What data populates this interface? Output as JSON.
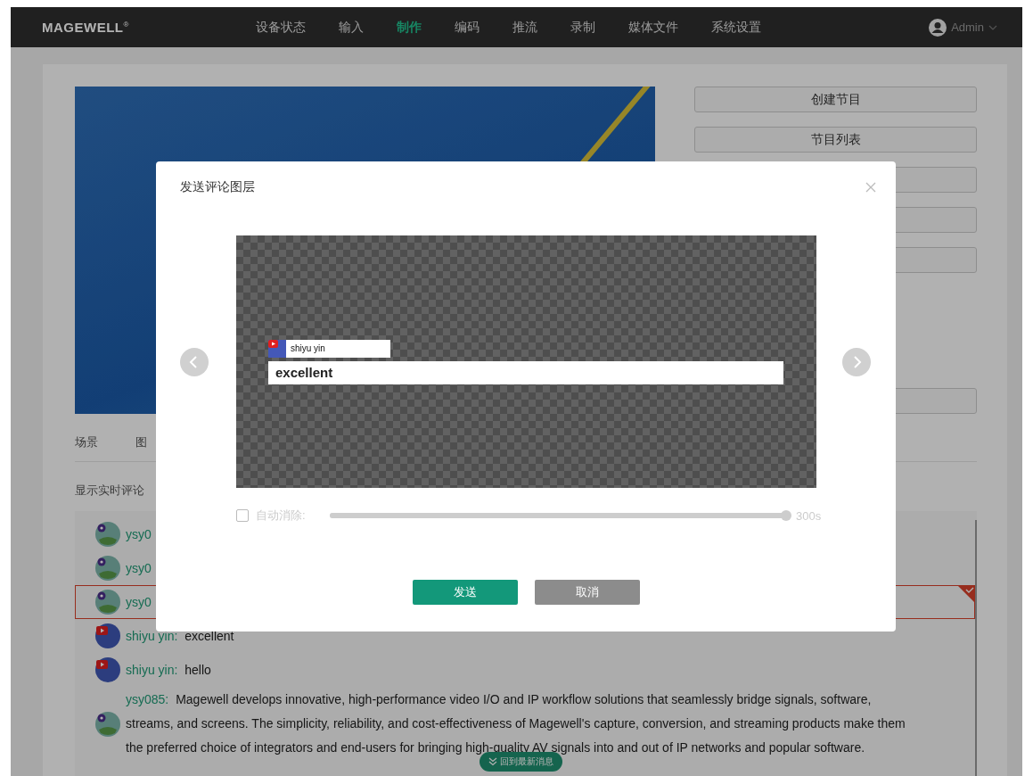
{
  "nav": {
    "logo": "MAGEWELL$^{®}$",
    "items": [
      {
        "label": "设备状态",
        "selected": false
      },
      {
        "label": "输入",
        "selected": false
      },
      {
        "label": "制作",
        "selected": true
      },
      {
        "label": "编码",
        "selected": false
      },
      {
        "label": "推流",
        "selected": false
      },
      {
        "label": "录制",
        "selected": false
      },
      {
        "label": "媒体文件",
        "selected": false
      },
      {
        "label": "系统设置",
        "selected": false
      }
    ],
    "user": "Admin"
  },
  "side_buttons": [
    "创建节目",
    "节目列表"
  ],
  "tabs": [
    "场景",
    "图"
  ],
  "live_comments": {
    "label": "显示实时评论",
    "comments": [
      {
        "kind": "pin",
        "name": "ysy0",
        "selected": false
      },
      {
        "kind": "pin",
        "name": "ysy0",
        "selected": false
      },
      {
        "kind": "pin",
        "name": "ysy0",
        "selected": true
      },
      {
        "kind": "channel",
        "name": "shiyu yin:",
        "text": "excellent",
        "selected": false
      },
      {
        "kind": "channel",
        "name": "shiyu yin:",
        "text": "hello",
        "selected": false
      },
      {
        "kind": "pin",
        "name": "ysy085:",
        "text": "Magewell develops innovative, high-performance video I/O and IP workflow solutions that seamlessly bridge signals, software, streams, and screens. The simplicity, reliability, and cost-effectiveness of Magewell's capture, conversion, and streaming products make them the preferred choice of integrators and end-users for bringing high-quality AV signals into and out of IP networks and popular software.",
        "selected": false
      }
    ],
    "jump_button": "回到最新消息"
  },
  "modal": {
    "title": "发送评论图层",
    "preview": {
      "author": "shiyu yin",
      "message": "excellent"
    },
    "auto_clear": {
      "label": "自动消除:",
      "checked": false,
      "disabled": true,
      "level": 1,
      "reading": "300s"
    },
    "buttons": [
      {
        "label": "发送",
        "kind": "primary"
      },
      {
        "label": "取消",
        "kind": "secondary"
      }
    ]
  }
}
